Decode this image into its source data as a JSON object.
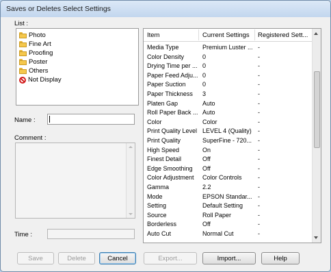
{
  "window": {
    "title": "Saves or Deletes Select Settings"
  },
  "list": {
    "label": "List :",
    "items": [
      {
        "label": "Photo",
        "icon": "folder-icon"
      },
      {
        "label": "Fine Art",
        "icon": "folder-icon"
      },
      {
        "label": "Proofing",
        "icon": "folder-icon"
      },
      {
        "label": "Poster",
        "icon": "folder-icon"
      },
      {
        "label": "Others",
        "icon": "folder-icon"
      },
      {
        "label": "Not Display",
        "icon": "no-entry-icon"
      }
    ]
  },
  "name_field": {
    "label": "Name :",
    "value": ""
  },
  "comment_field": {
    "label": "Comment :",
    "value": ""
  },
  "time_field": {
    "label": "Time :",
    "value": ""
  },
  "table": {
    "headers": [
      "Item",
      "Current Settings",
      "Registered Sett..."
    ],
    "rows": [
      [
        "Media Type",
        "Premium Luster ...",
        "-"
      ],
      [
        "Color Density",
        "0",
        "-"
      ],
      [
        "Drying Time per ...",
        "0",
        "-"
      ],
      [
        "Paper Feed Adju...",
        "0",
        "-"
      ],
      [
        "Paper Suction",
        "0",
        "-"
      ],
      [
        "Paper Thickness",
        "3",
        "-"
      ],
      [
        "Platen Gap",
        "Auto",
        "-"
      ],
      [
        "Roll Paper Back ...",
        "Auto",
        "-"
      ],
      [
        "Color",
        "Color",
        "-"
      ],
      [
        "Print Quality Level",
        "LEVEL 4 (Quality)",
        "-"
      ],
      [
        "Print Quality",
        "SuperFine - 720...",
        "-"
      ],
      [
        "High Speed",
        "On",
        "-"
      ],
      [
        "Finest Detail",
        "Off",
        "-"
      ],
      [
        "Edge Smoothing",
        "Off",
        "-"
      ],
      [
        "Color Adjustment",
        "Color Controls",
        "-"
      ],
      [
        "Gamma",
        "2.2",
        "-"
      ],
      [
        "Mode",
        "EPSON Standar...",
        "-"
      ],
      [
        "Setting",
        "Default Setting",
        "-"
      ],
      [
        "Source",
        "Roll Paper",
        "-"
      ],
      [
        "Borderless",
        "Off",
        "-"
      ],
      [
        "Auto Cut",
        "Normal Cut",
        "-"
      ]
    ]
  },
  "buttons": {
    "save": "Save",
    "delete": "Delete",
    "cancel": "Cancel",
    "export": "Export...",
    "import": "Import...",
    "help": "Help"
  }
}
